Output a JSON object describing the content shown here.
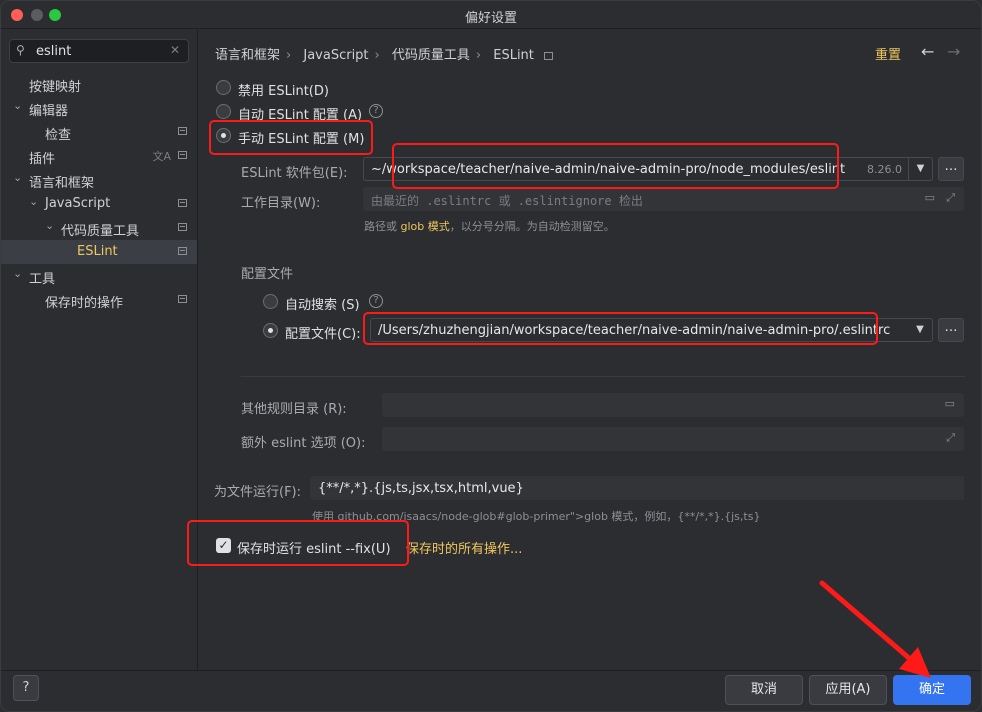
{
  "window": {
    "title": "偏好设置"
  },
  "sidebar": {
    "search_value": "eslint",
    "items": [
      {
        "label": "按键映射",
        "chevron": "",
        "marker": false,
        "translate": false,
        "selected": false
      },
      {
        "label": "编辑器",
        "chevron": "⌄",
        "marker": false,
        "translate": false,
        "selected": false
      },
      {
        "label": "检查",
        "chevron": "",
        "marker": true,
        "translate": false,
        "selected": false
      },
      {
        "label": "插件",
        "chevron": "",
        "marker": true,
        "translate": true,
        "selected": false
      },
      {
        "label": "语言和框架",
        "chevron": "⌄",
        "marker": false,
        "translate": false,
        "selected": false
      },
      {
        "label": "JavaScript",
        "chevron": "⌄",
        "marker": true,
        "translate": false,
        "selected": false
      },
      {
        "label": "代码质量工具",
        "chevron": "⌄",
        "marker": true,
        "translate": false,
        "selected": false
      },
      {
        "label": "ESLint",
        "chevron": "",
        "marker": true,
        "translate": false,
        "selected": true
      },
      {
        "label": "工具",
        "chevron": "⌄",
        "marker": false,
        "translate": false,
        "selected": false
      },
      {
        "label": "保存时的操作",
        "chevron": "",
        "marker": true,
        "translate": false,
        "selected": false
      }
    ]
  },
  "header": {
    "breadcrumb": [
      "语言和框架",
      "JavaScript",
      "代码质量工具",
      "ESLint"
    ],
    "reset_label": "重置"
  },
  "eslint": {
    "mode_options": [
      {
        "label": "禁用 ESLint(D)",
        "selected": false
      },
      {
        "label": "自动 ESLint 配置 (A)",
        "selected": false
      },
      {
        "label": "手动 ESLint 配置 (M)",
        "selected": true
      }
    ],
    "package_label": "ESLint 软件包(E):",
    "package_value": "~/workspace/teacher/naive-admin/naive-admin-pro/node_modules/eslint",
    "package_version": "8.26.0",
    "workdir_label": "工作目录(W):",
    "workdir_placeholder": "由最近的 .eslintrc 或 .eslintignore 检出",
    "workdir_hint_prefix": "路径或",
    "workdir_hint_glob": "glob 模式",
    "workdir_hint_suffix": "，以分号分隔。为自动检测留空。",
    "config_section_title": "配置文件",
    "config_options": [
      {
        "label": "自动搜索 (S)",
        "selected": false
      },
      {
        "label": "配置文件(C):",
        "selected": true
      }
    ],
    "config_file_value": "/Users/zhuzhengjian/workspace/teacher/naive-admin/naive-admin-pro/.eslintrc",
    "extra_rules_label": "其他规则目录 (R):",
    "extra_options_label": "额外 eslint 选项 (O):",
    "run_for_files_label": "为文件运行(F):",
    "run_for_files_value": "{**/*,*}.{js,ts,jsx,tsx,html,vue}",
    "run_for_files_hint": "使用 github.com/isaacs/node-glob#glob-primer\">glob 模式，例如，{**/*,*}.{js,ts}",
    "fix_on_save_label": "保存时运行 eslint --fix(U)",
    "fix_on_save_checked": true,
    "save_actions_link": "保存时的所有操作..."
  },
  "footer": {
    "help_label": "?",
    "cancel_label": "取消",
    "apply_label": "应用(A)",
    "ok_label": "确定"
  },
  "colors": {
    "accent": "#3574f0",
    "highlight": "#f0c75e",
    "annotation": "#ff1a1a"
  }
}
